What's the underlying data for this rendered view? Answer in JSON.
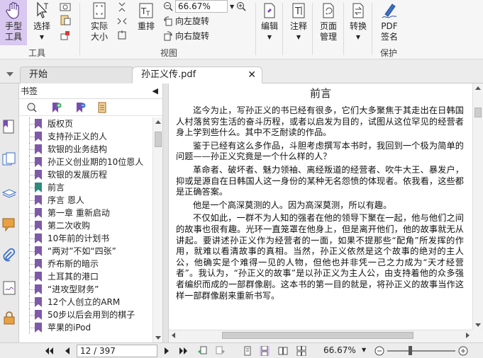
{
  "ribbon": {
    "hand_tool": "手型\n工具",
    "select": "选择",
    "group_tools": "工具",
    "actual_size": "实际\n大小",
    "reflow": "重排",
    "zoom_value": "66.67%",
    "rotate_left": "向左旋转",
    "rotate_right": "向右旋转",
    "group_view": "视图",
    "edit": "编辑",
    "annotate": "注释",
    "page_manage": "页面\n管理",
    "convert": "转换",
    "pdf_sign": "PDF\n签名",
    "group_protect": "保护"
  },
  "tabs": {
    "home": "开始",
    "document": "孙正义传.pdf",
    "close_symbol": "✕"
  },
  "bookmarks": {
    "title": "书签",
    "items": [
      "版权页",
      "支持孙正义的人",
      "软银的业务结构",
      "孙正义创业期的10位恩人",
      "软银的发展历程",
      "前言",
      "序言 恩人",
      "第一章 重新启动",
      "第二次收购",
      "10年前的计划书",
      "“两对”不如“四张”",
      "乔布斯的暗示",
      "土耳其的港口",
      "“进攻型财务”",
      "12个人创立的ARM",
      "50步以后会用到的棋子",
      "苹果的iPod"
    ],
    "active_index": 5
  },
  "document": {
    "heading": "前言",
    "paragraphs": [
      "迄今为止，写孙正义的书已经有很多，它们大多聚焦于其走出在日韩国人村落贫穷生活的奋斗历程，或者以启发为目的，试图从这位罕见的经营者身上学到些什么。其中不乏耐读的作品。",
      "鉴于已经有这么多作品，斗胆考虑撰写本书时，我回到一个极为简单的问题——孙正义究竟是一个什么样的人？",
      "革命者、破坏者、魅力领袖、离经叛道的经营者、吹牛大王、暴发户，抑或是源自在日韩国人这一身份的某种无名怨愤的体现者。依我看，这些都是正确答案。",
      "他是一个高深莫测的人。因为高深莫测，所以有趣。",
      "不仅如此，一群不为人知的强者在他的领导下聚在一起，他与他们之间的故事也很有趣。光环一直笼罩在他身上，但是离开他们，他的故事就无从讲起。要讲述孙正义作为经营者的一面，如果不提那些“配角”所发挥的作用，就难以看清故事的真相。当然，孙正义依然是这个故事的绝对的主人公，他确实是个难得一见的人物，但他也并非凭一己之力成为“天才经营者”。我认为，“孙正义的故事”是以孙正义为主人公，由支持着他的众多强者编织而成的一部群像剧。这本书的第一目的就是，将孙正义的故事当作这样一部群像剧来重新书写。"
    ]
  },
  "status": {
    "page_display": "12 / 397",
    "zoom": "66.67%"
  },
  "colors": {
    "accent_purple": "#7a4bb3",
    "bookmark_flag": "#7f5aa8",
    "active_flag": "#2e8b7a",
    "hand_tool_bg": "#d9c8ef"
  }
}
